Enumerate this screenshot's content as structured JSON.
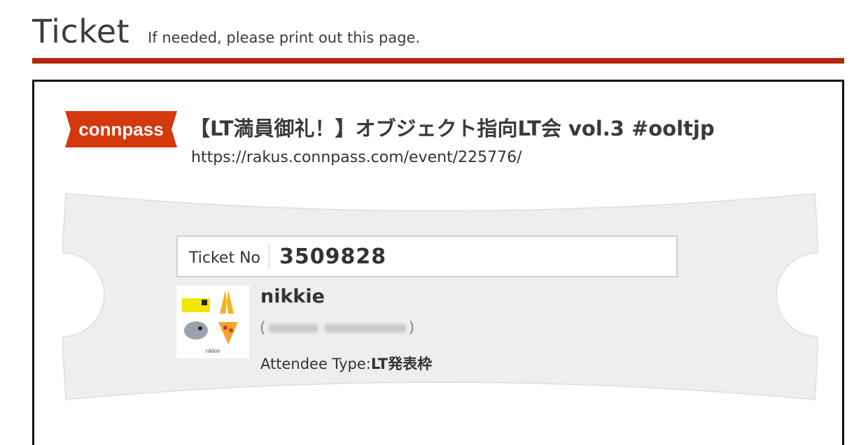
{
  "header": {
    "title": "Ticket",
    "subtitle": "If needed, please print out this page."
  },
  "logo": {
    "text": "connpass",
    "color": "#d4380d"
  },
  "event": {
    "title": "【LT満員御礼！】オブジェクト指向LT会 vol.3 #ooltjp",
    "url": "https://rakus.connpass.com/event/225776/"
  },
  "ticket": {
    "number_label": "Ticket No",
    "number": "3509828"
  },
  "attendee": {
    "avatar_caption": "nikkie",
    "name": "nikkie",
    "paren_open": "(",
    "paren_close": ")",
    "type_label": "Attendee Type:",
    "type_value": "LT発表枠"
  },
  "colors": {
    "accent_rule": "#b42708",
    "ticket_bg": "#eeeeee"
  }
}
